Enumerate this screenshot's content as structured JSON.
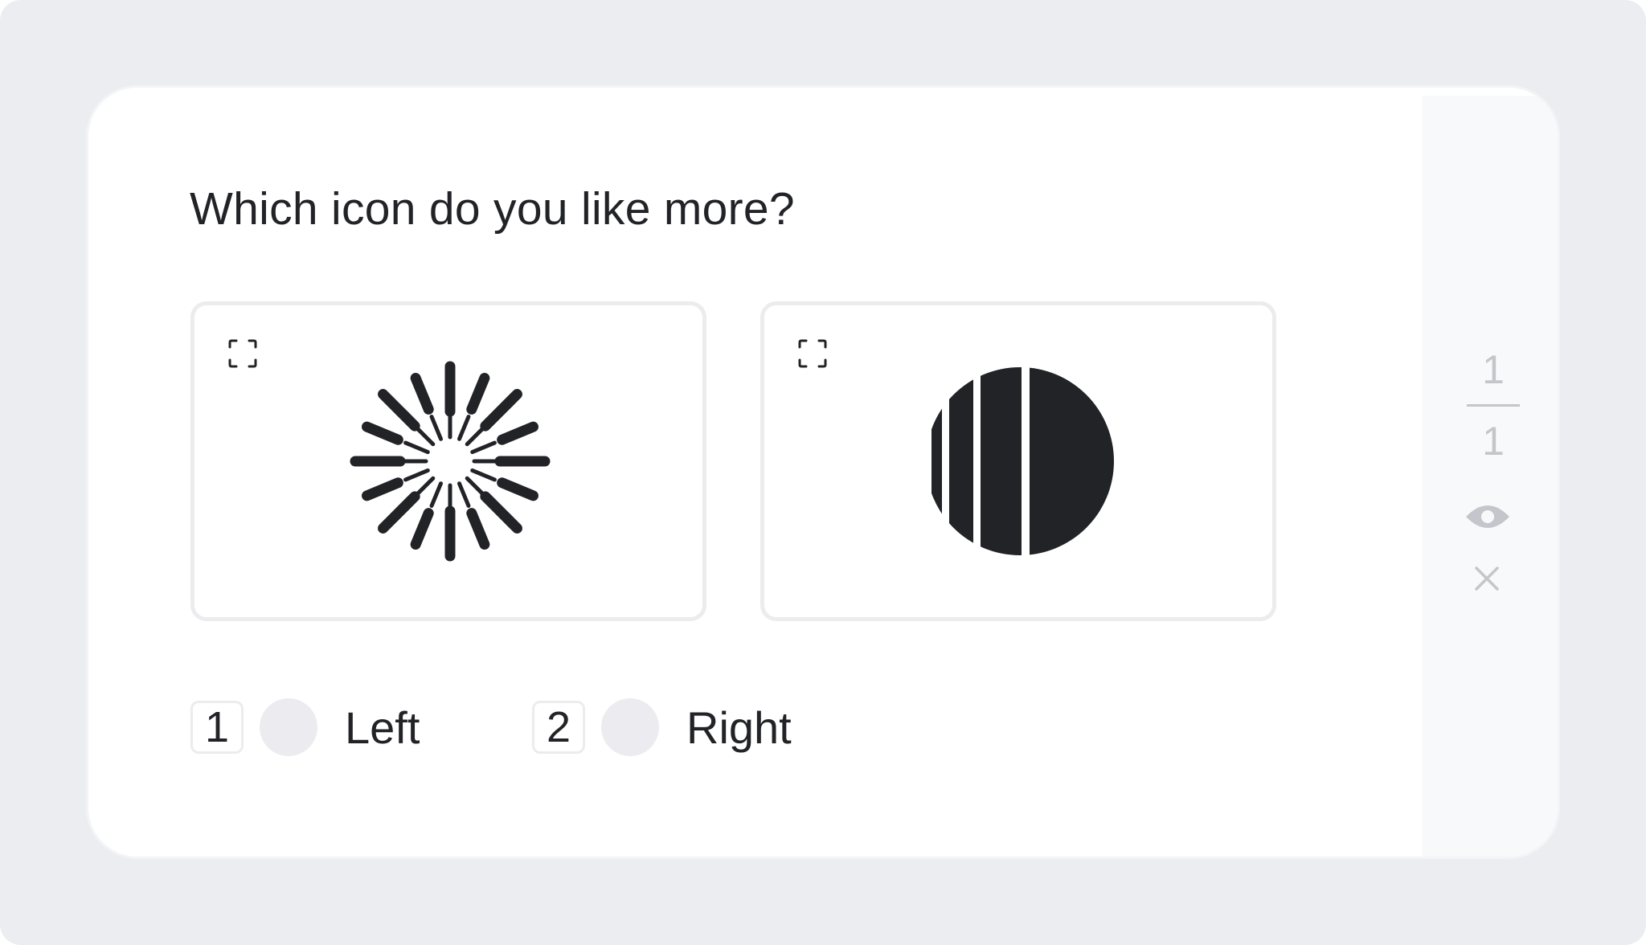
{
  "question": "Which icon do you like more?",
  "options": [
    {
      "side": "left",
      "icon": "radiating-burst-icon",
      "key": "1",
      "label": "Left",
      "selected": false
    },
    {
      "side": "right",
      "icon": "striped-half-circle-icon",
      "key": "2",
      "label": "Right",
      "selected": false
    }
  ],
  "progress": {
    "current": "1",
    "total": "1"
  },
  "side_controls": {
    "preview": "eye-icon",
    "close": "close-icon"
  },
  "colors": {
    "background": "#ecedf1",
    "card": "#ffffff",
    "side_panel": "#f8f9fb",
    "text": "#222327",
    "muted": "#c5c6cb",
    "border": "#ececee",
    "radio": "#ececf0"
  }
}
